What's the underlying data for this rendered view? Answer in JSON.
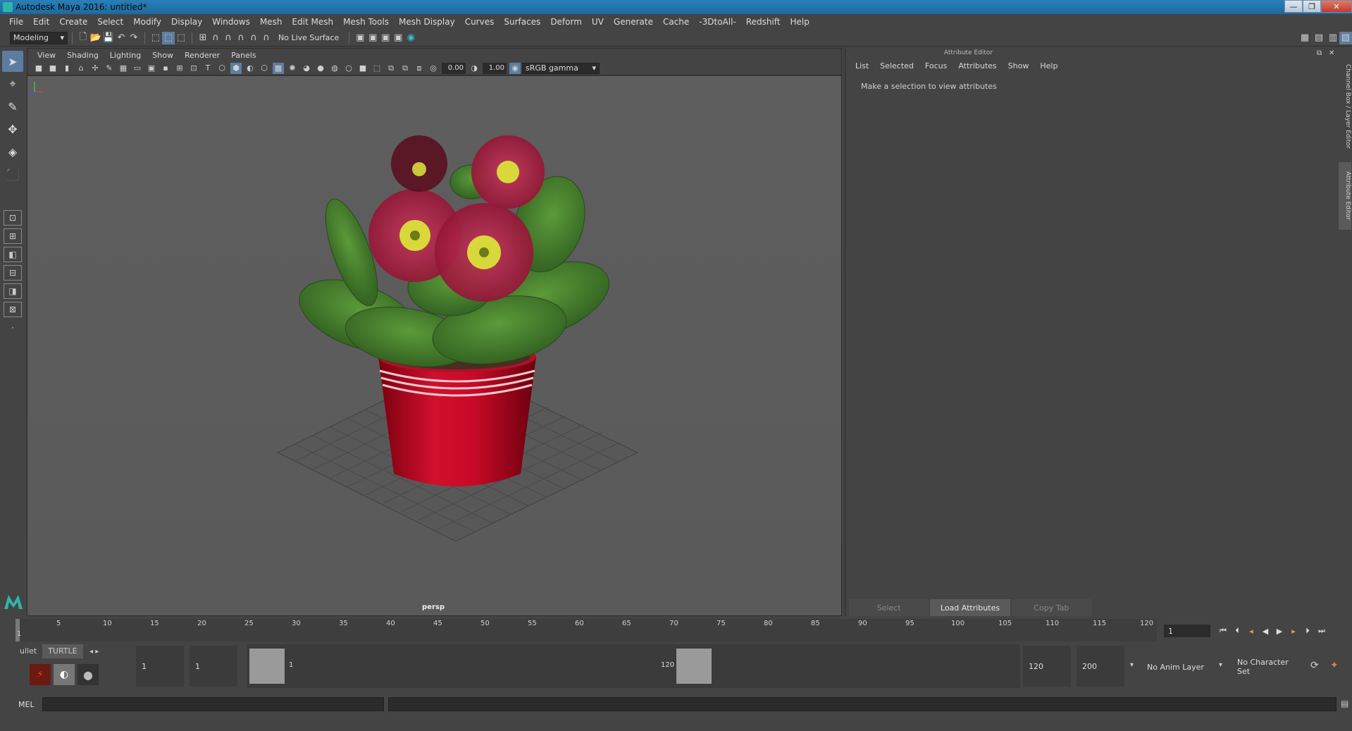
{
  "window": {
    "title": "Autodesk Maya 2016: untitled*",
    "minimize": "—",
    "maximize": "❐",
    "close": "✕"
  },
  "menubar": {
    "items": [
      "File",
      "Edit",
      "Create",
      "Select",
      "Modify",
      "Display",
      "Windows",
      "Mesh",
      "Edit Mesh",
      "Mesh Tools",
      "Mesh Display",
      "Curves",
      "Surfaces",
      "Deform",
      "UV",
      "Generate",
      "Cache",
      "-3DtoAll-",
      "Redshift",
      "Help"
    ]
  },
  "statusline": {
    "mode": "Modeling",
    "live_surface": "No Live Surface"
  },
  "viewport": {
    "menu": [
      "View",
      "Shading",
      "Lighting",
      "Show",
      "Renderer",
      "Panels"
    ],
    "field_a": "0.00",
    "field_b": "1.00",
    "color_space": "sRGB gamma",
    "camera_label": "persp"
  },
  "attribute_editor": {
    "title": "Attribute Editor",
    "menu": [
      "List",
      "Selected",
      "Focus",
      "Attributes",
      "Show",
      "Help"
    ],
    "message": "Make a selection to view attributes",
    "buttons": {
      "select": "Select",
      "load": "Load Attributes",
      "copy": "Copy Tab"
    }
  },
  "side_tabs": {
    "channel_box": "Channel Box / Layer Editor",
    "attribute_editor": "Attribute Editor"
  },
  "timeslider": {
    "labels": [
      "1",
      "5",
      "10",
      "15",
      "20",
      "25",
      "30",
      "35",
      "40",
      "45",
      "50",
      "55",
      "60",
      "65",
      "70",
      "75",
      "80",
      "85",
      "90",
      "95",
      "100",
      "105",
      "110",
      "115",
      "120"
    ],
    "current_frame": "1"
  },
  "range": {
    "shelf_tabs": [
      "ullet",
      "TURTLE"
    ],
    "start_time": "1",
    "playback_start": "1",
    "range_start_label": "1",
    "range_end_label": "120",
    "playback_end": "120",
    "end_time": "200",
    "anim_layer": "No Anim Layer",
    "character_set": "No Character Set"
  },
  "cmdline": {
    "mode": "MEL"
  }
}
